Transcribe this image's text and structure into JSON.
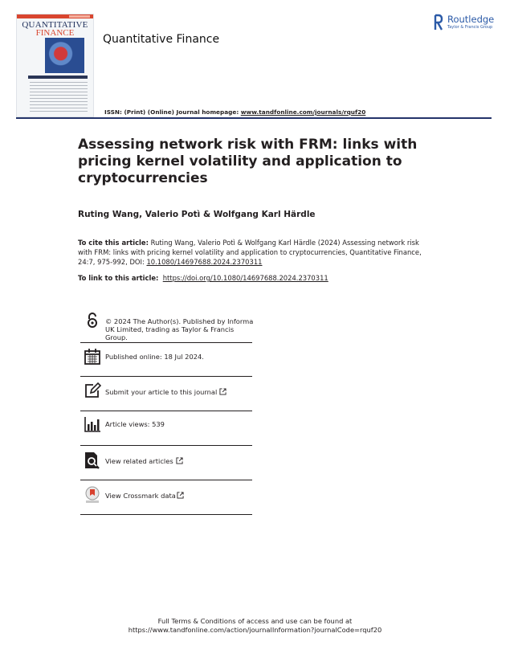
{
  "header": {
    "cover": {
      "title_line1": "QUANTITATIVE",
      "title_line2": "FINANCE"
    },
    "journal_title": "Quantitative Finance",
    "publisher": {
      "name": "Routledge",
      "tagline": "Taylor & Francis Group"
    },
    "issn_line": "ISSN: (Print) (Online) Journal homepage: ",
    "homepage_link": "www.tandfonline.com/journals/rquf20"
  },
  "article": {
    "title": "Assessing network risk with FRM: links with pricing kernel volatility and application to cryptocurrencies",
    "authors": "Ruting Wang, Valerio Potì & Wolfgang Karl Härdle",
    "cite_label": "To cite this article:",
    "cite_text": " Ruting Wang, Valerio Potì & Wolfgang Karl Härdle (2024) Assessing network risk with FRM: links with pricing kernel volatility and application to cryptocurrencies, Quantitative Finance, 24:7, 975-992, DOI: ",
    "doi": "10.1080/14697688.2024.2370311",
    "link_label": "To link to this article:",
    "link_url": "https://doi.org/10.1080/14697688.2024.2370311"
  },
  "info_rows": {
    "license": "© 2024 The Author(s). Published by Informa UK Limited, trading as Taylor & Francis Group.",
    "published": "Published online: 18 Jul 2024.",
    "submit": "Submit your article to this journal",
    "views": "Article views: 539",
    "related": "View related articles",
    "crossmark": "View Crossmark data"
  },
  "footer": {
    "line1": "Full Terms & Conditions of access and use can be found at",
    "line2": "https://www.tandfonline.com/action/journalInformation?journalCode=rquf20"
  },
  "colors": {
    "rule": "#24346a",
    "routledge_blue": "#2b5aa7",
    "text": "#231f20"
  }
}
